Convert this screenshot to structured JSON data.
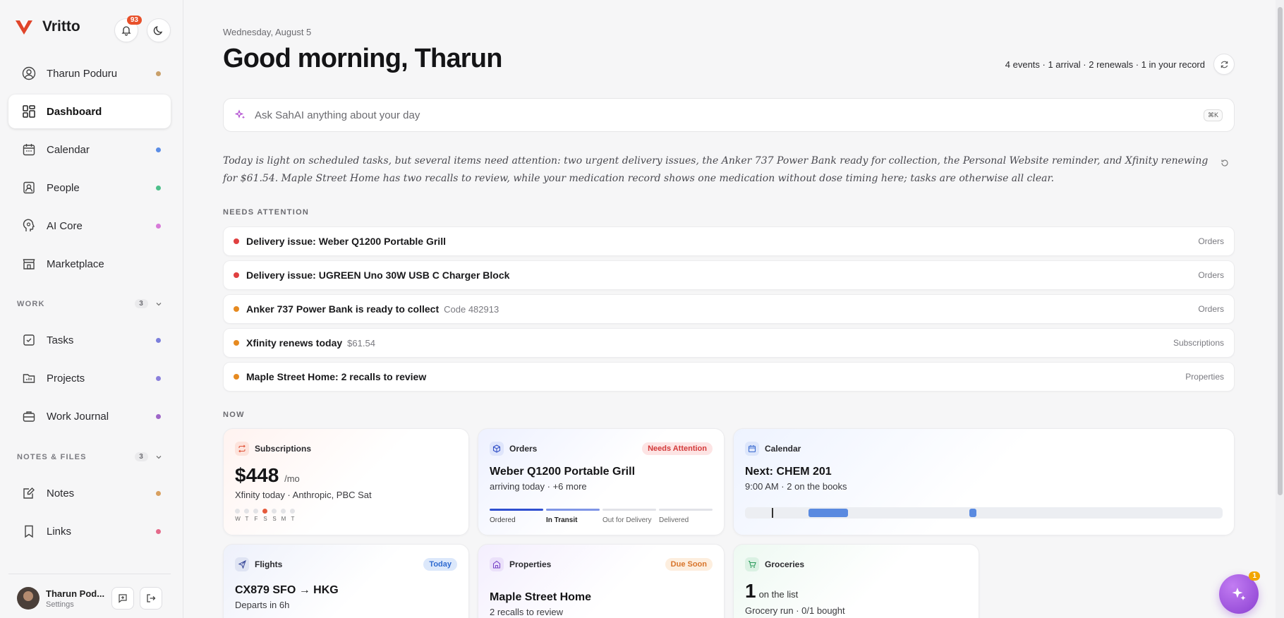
{
  "app": {
    "name": "Vritto",
    "notifications": "93"
  },
  "sidebar": {
    "user_label": "Tharun Poduru",
    "items": [
      {
        "label": "Dashboard"
      },
      {
        "label": "Calendar"
      },
      {
        "label": "People"
      },
      {
        "label": "AI Core"
      },
      {
        "label": "Marketplace"
      }
    ],
    "work": {
      "title": "WORK",
      "count": "3",
      "items": [
        {
          "label": "Tasks"
        },
        {
          "label": "Projects"
        },
        {
          "label": "Work Journal"
        }
      ]
    },
    "notes": {
      "title": "NOTES & FILES",
      "count": "3",
      "items": [
        {
          "label": "Notes"
        },
        {
          "label": "Links"
        }
      ]
    },
    "footer": {
      "name": "Tharun Pod...",
      "sub": "Settings"
    }
  },
  "header": {
    "date": "Wednesday, August 5",
    "greeting": "Good morning, Tharun",
    "summary": "4 events · 1 arrival · 2 renewals · 1 in your record"
  },
  "ask": {
    "placeholder": "Ask SahAI anything about your day",
    "shortcut": "⌘K"
  },
  "ai_summary": "Today is light on scheduled tasks, but several items need attention: two urgent delivery issues, the Anker 737 Power Bank ready for collection, the Personal Website reminder, and Xfinity renewing for $61.54. Maple Street Home has two recalls to review, while your medication record shows one medication without dose timing here; tasks are otherwise all clear.",
  "needs_attention": {
    "title": "NEEDS ATTENTION",
    "items": [
      {
        "title": "Delivery issue: Weber Q1200 Portable Grill",
        "sub": "",
        "category": "Orders"
      },
      {
        "title": "Delivery issue: UGREEN Uno 30W USB C Charger Block",
        "sub": "",
        "category": "Orders"
      },
      {
        "title": "Anker 737 Power Bank is ready to collect",
        "sub": "Code 482913",
        "category": "Orders"
      },
      {
        "title": "Xfinity renews today",
        "sub": "$61.54",
        "category": "Subscriptions"
      },
      {
        "title": "Maple Street Home: 2 recalls to review",
        "sub": "",
        "category": "Properties"
      }
    ]
  },
  "now": {
    "title": "NOW",
    "subscriptions": {
      "title": "Subscriptions",
      "amount": "$448",
      "per": "/mo",
      "sub": "Xfinity today · Anthropic, PBC Sat",
      "days": [
        "W",
        "T",
        "F",
        "S",
        "S",
        "M",
        "T"
      ]
    },
    "orders": {
      "title": "Orders",
      "badge": "Needs Attention",
      "main": "Weber Q1200 Portable Grill",
      "sub": "arriving today · +6 more",
      "steps": [
        "Ordered",
        "In Transit",
        "Out for Delivery",
        "Delivered"
      ]
    },
    "calendar": {
      "title": "Calendar",
      "main": "Next: CHEM 201",
      "sub": "9:00 AM · 2 on the books"
    },
    "flights": {
      "title": "Flights",
      "badge": "Today",
      "main": "CX879 SFO → HKG",
      "sub": "Departs in 6h"
    },
    "properties": {
      "title": "Properties",
      "badge": "Due Soon",
      "main": "Maple Street Home",
      "sub": "2 recalls to review"
    },
    "groceries": {
      "title": "Groceries",
      "count": "1",
      "count_label": "on the list",
      "sub": "Grocery run · 0/1 bought"
    }
  },
  "fab_badge": "1"
}
